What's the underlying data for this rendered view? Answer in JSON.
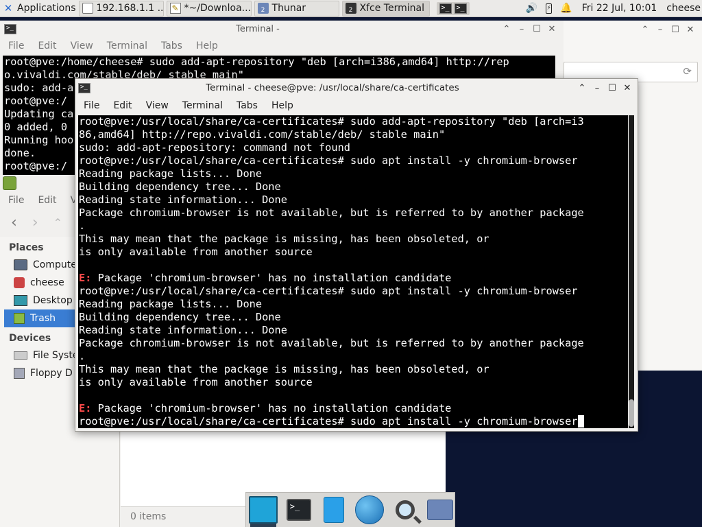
{
  "panel": {
    "applications": "Applications",
    "tasks": [
      {
        "label": "192.168.1.1 ...",
        "icon": "browser-icon"
      },
      {
        "label": "*~/Downloa...",
        "icon": "text-editor-icon"
      },
      {
        "label": "Thunar",
        "icon": "folder-icon",
        "badge": "2"
      },
      {
        "label": "Xfce Terminal",
        "icon": "terminal-icon",
        "badge": "2"
      }
    ],
    "clock": "Fri 22 Jul, 10:01",
    "user": "cheese"
  },
  "back_terminal": {
    "title": "Terminal -",
    "menu": [
      "File",
      "Edit",
      "View",
      "Terminal",
      "Tabs",
      "Help"
    ],
    "lines": [
      "root@pve:/home/cheese# sudo add-apt-repository \"deb [arch=i386,amd64] http://rep",
      "o.vivaldi.com/stable/deb/ stable main\"",
      "sudo: add-a",
      "root@pve:/",
      "Updating ca",
      "0 added, 0",
      "Running hoo",
      "done.",
      "root@pve:/"
    ]
  },
  "thunar": {
    "menu": [
      "File",
      "Edit",
      "Vi"
    ],
    "places_header": "Places",
    "places": [
      "Compute",
      "cheese",
      "Desktop",
      "Trash"
    ],
    "devices_header": "Devices",
    "devices": [
      "File Syste",
      "Floppy D"
    ],
    "status": "0 items"
  },
  "front_terminal": {
    "title": "Terminal - cheese@pve: /usr/local/share/ca-certificates",
    "menu": [
      "File",
      "Edit",
      "View",
      "Terminal",
      "Tabs",
      "Help"
    ],
    "lines": [
      "root@pve:/usr/local/share/ca-certificates# sudo add-apt-repository \"deb [arch=i3",
      "86,amd64] http://repo.vivaldi.com/stable/deb/ stable main\"",
      "sudo: add-apt-repository: command not found",
      "root@pve:/usr/local/share/ca-certificates# sudo apt install -y chromium-browser",
      "Reading package lists... Done",
      "Building dependency tree... Done",
      "Reading state information... Done",
      "Package chromium-browser is not available, but is referred to by another package",
      ".",
      "This may mean that the package is missing, has been obsoleted, or",
      "is only available from another source",
      "",
      "E: Package 'chromium-browser' has no installation candidate",
      "root@pve:/usr/local/share/ca-certificates# sudo apt install -y chromium-browser",
      "Reading package lists... Done",
      "Building dependency tree... Done",
      "Reading state information... Done",
      "Package chromium-browser is not available, but is referred to by another package",
      ".",
      "This may mean that the package is missing, has been obsoleted, or",
      "is only available from another source",
      "",
      "E: Package 'chromium-browser' has no installation candidate",
      "root@pve:/usr/local/share/ca-certificates# sudo apt install -y chromium-browser"
    ]
  },
  "dock": [
    "show-desktop-icon",
    "terminal-icon",
    "file-manager-icon",
    "web-browser-icon",
    "app-finder-icon",
    "home-folder-icon"
  ],
  "colors": {
    "accent": "#3a7dd3",
    "error": "#ff4b4b",
    "panel": "#ebeae8"
  }
}
